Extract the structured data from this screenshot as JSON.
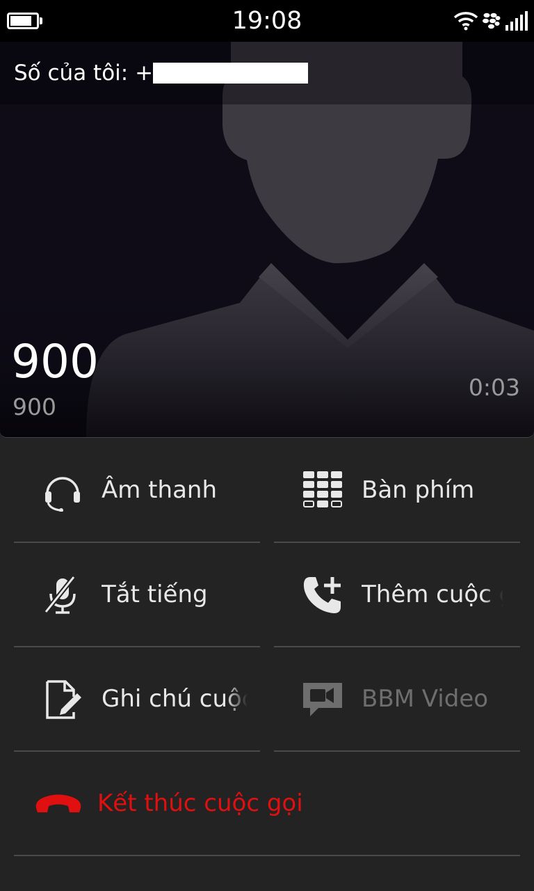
{
  "status_bar": {
    "time": "19:08",
    "battery_level": 0.85,
    "icons": [
      "battery-icon",
      "wifi-icon",
      "blackberry-icon",
      "signal-icon"
    ]
  },
  "caller": {
    "my_number_label": "Số của tôi: +",
    "name": "900",
    "number": "900",
    "duration": "0:03"
  },
  "actions": {
    "audio": {
      "label": "Âm thanh",
      "icon": "headset-icon"
    },
    "keypad": {
      "label": "Bàn phím",
      "icon": "keypad-icon"
    },
    "mute": {
      "label": "Tắt tiếng",
      "icon": "mic-muted-icon"
    },
    "add_call": {
      "label": "Thêm cuộc gọi",
      "icon": "add-call-icon"
    },
    "notes": {
      "label": "Ghi chú cuộc gọi",
      "icon": "note-edit-icon"
    },
    "bbm_video": {
      "label": "BBM Video",
      "icon": "video-chat-icon",
      "enabled": false
    },
    "end_call": {
      "label": "Kết thúc cuộc gọi",
      "icon": "hang-up-icon",
      "color": "#e01010"
    }
  },
  "colors": {
    "background": "#232323",
    "end_call": "#e01010",
    "divider": "#4a4a4a"
  }
}
